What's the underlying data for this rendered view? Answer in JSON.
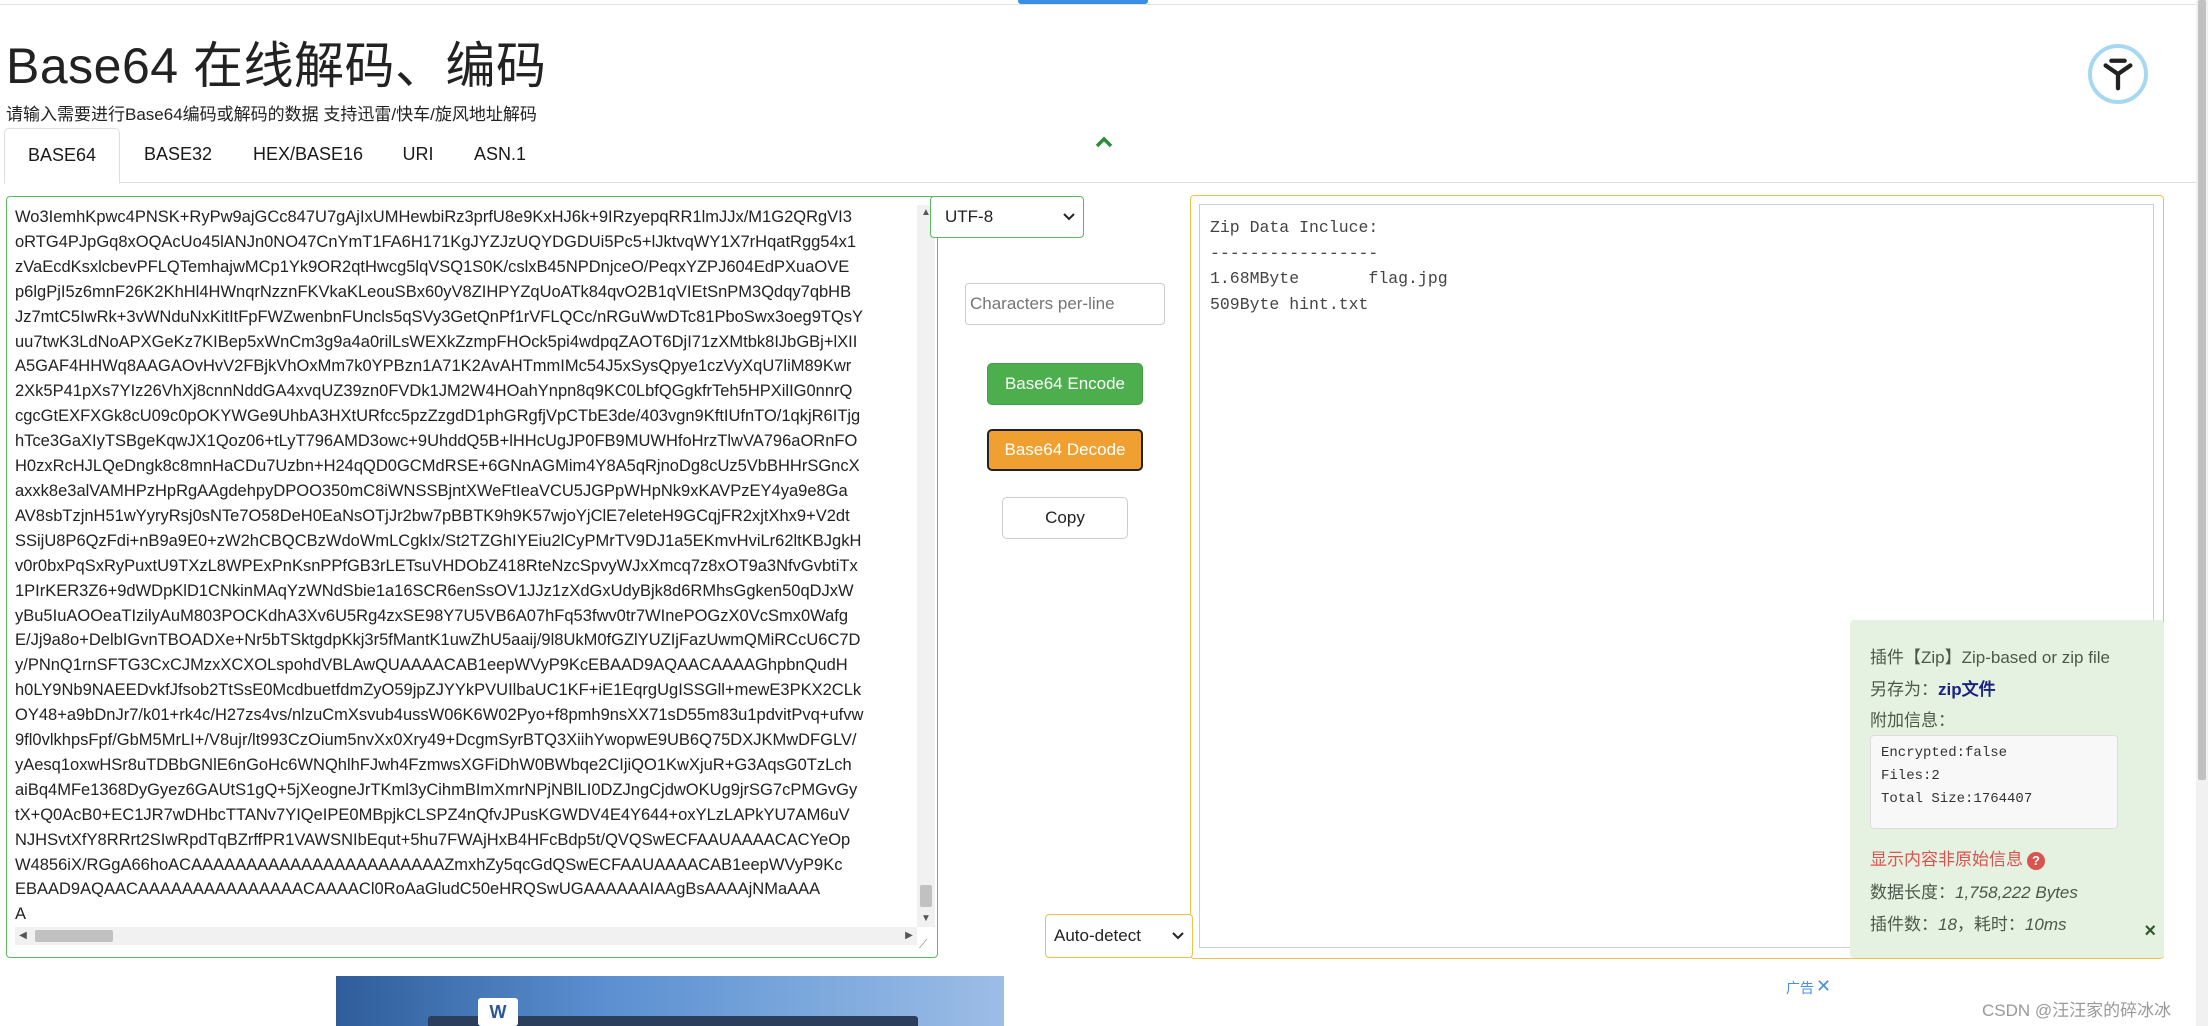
{
  "header": {
    "title": "Base64 在线解码、编码",
    "subtitle": "请输入需要进行Base64编码或解码的数据 支持迅雷/快车/旋风地址解码"
  },
  "tabs": [
    {
      "label": "BASE64",
      "active": true
    },
    {
      "label": "BASE32",
      "active": false
    },
    {
      "label": "HEX/BASE16",
      "active": false
    },
    {
      "label": "URI",
      "active": false
    },
    {
      "label": "ASN.1",
      "active": false
    }
  ],
  "input": {
    "lines": [
      "Wo3IemhKpwc4PNSK+RyPw9ajGCc847U7gAjIxUMHewbiRz3prfU8e9KxHJ6k+9IRzyepqRR1lmJJx/M1G2QRgVI3",
      "oRTG4PJpGq8xOQAcUo45lANJn0NO47CnYmT1FA6H171KgJYZJzUQYDGDUi5Pc5+lJktvqWY1X7rHqatRgg54x1",
      "zVaEcdKsxlcbevPFLQTemhajwMCp1Yk9OR2qtHwcg5lqVSQ1S0K/cslxB45NPDnjceO/PeqxYZPJ604EdPXuaOVE",
      "p6lgPjI5z6mnF26K2KhHl4HWnqrNzznFKVkaKLeouSBx60yV8ZIHPYZqUoATk84qvO2B1qVIEtSnPM3Qdqy7qbHB",
      "Jz7mtC5IwRk+3vWNduNxKitItFpFWZwenbnFUncls5qSVy3GetQnPf1rVFLQCc/nRGuWwDTc81PboSwx3oeg9TQsY",
      "uu7twK3LdNoAPXGeKz7KIBep5xWnCm3g9a4a0rilLsWEXkZzmpFHOck5pi4wdpqZAOT6DjI71zXMtbk8IJbGBj+lXII",
      "A5GAF4HHWq8AAGAOvHvV2FBjkVhOxMm7k0YPBzn1A71K2AvAHTmmIMc54J5xSysQpye1czVyXqU7liM89Kwr",
      "2Xk5P41pXs7YIz26VhXj8cnnNddGA4xvqUZ39zn0FVDk1JM2W4HOahYnpn8q9KC0LbfQGgkfrTeh5HPXilIG0nnrQ",
      "cgcGtEXFXGk8cU09c0pOKYWGe9UhbA3HXtURfcc5pzZzgdD1phGRgfjVpCTbE3de/403vgn9KftIUfnTO/1qkjR6ITjg",
      "hTce3GaXIyTSBgeKqwJX1Qoz06+tLyT796AMD3owc+9UhddQ5B+lHHcUgJP0FB9MUWHfoHrzTlwVA796aORnFO",
      "H0zxRcHJLQeDngk8c8mnHaCDu7Uzbn+H24qQD0GCMdRSE+6GNnAGMim4Y8A5qRjnoDg8cUz5VbBHHrSGncX",
      "axxk8e3alVAMHPzHpRgAAgdehpyDPOO350mC8iWNSSBjntXWeFtIeaVCU5JGPpWHpNk9xKAVPzEY4ya9e8Ga",
      "AV8sbTzjnH51wYyryRsj0sNTe7O58DeH0EaNsOTjJr2bw7pBBTK9h9K57wjoYjClE7eleteH9GCqjFR2xjtXhx9+V2dt",
      "SSijU8P6QzFdi+nB9a9E0+zW2hCBQCBzWdoWmLCgkIx/St2TZGhIYEiu2lCyPMrTV9DJ1a5EKmvHviLr62ltKBJgkH",
      "v0r0bxPqSxRyPuxtU9TXzL8WPExPnKsnPPfGB3rLETsuVHDObZ418RteNzcSpvyWJxXmcq7z8xOT9a3NfvGvbtiTx",
      "1PIrKER3Z6+9dWDpKlD1CNkinMAqYzWNdSbie1a16SCR6enSsOV1JJz1zXdGxUdyBjk8d6RMhsGgken50qDJxW",
      "yBu5IuAOOeaTIzilyAuM803POCKdhA3Xv6U5Rg4zxSE98Y7U5VB6A07hFq53fwv0tr7WInePOGzX0VcSmx0Wafg",
      "E/Jj9a8o+DelbIGvnTBOADXe+Nr5bTSktgdpKkj3r5fMantK1uwZhU5aaij/9l8UkM0fGZlYUZIjFazUwmQMiRCcU6C7D",
      "y/PNnQ1rnSFTG3CxCJMzxXCXOLspohdVBLAwQUAAAACAB1eepWVyP9KcEBAAD9AQAACAAAAGhpbnQudH",
      "h0LY9Nb9NAEEDvkfJfsob2TtSsE0McdbuetfdmZyO59jpZJYYkPVUIlbaUC1KF+iE1EqrgUgISSGll+mewE3PKX2CLk",
      "OY48+a9bDnJr7/k01+rk4c/H27zs4vs/nlzuCmXsvub4ussW06K6W02Pyo+f8pmh9nsXX71sD55m83u1pdvitPvq+ufvw",
      "9fl0vlkhpsFpf/GbM5MrLI+/V8ujr/lt993CzOium5nvXx0Xry49+DcgmSyrBTQ3XiihYwopwE9UB6Q75DXJKMwDFGLV/",
      "yAesq1oxwHSr8uTDBbGNlE6nGoHc6WNQhlhFJwh4FzmwsXGFiDhW0BWbqe2CIjiQO1KwXjuR+G3AqsG0TzLch",
      "aiBq4MFe1368DyGyez6GAUtS1gQ+5jXeogneJrTKml3yCihmBImXmrNPjNBlLI0DZJngCjdwOKUg9jrSG7cPMGvGy",
      "tX+Q0AcB0+EC1JR7wDHbcTTANv7YIQeIPE0MBpjkCLSPZ4nQfvJPusKGWDV4E4Y644+oxYLzLAPkYU7AM6uV",
      "NJHSvtXfY8RRrt2SIwRpdTqBZrffPR1VAWSNIbEqut+5hu7FWAjHxB4HFcBdp5t/QVQSwECFAAUAAAACACYeOp",
      "W4856iX/RGgA66hoACAAAAAAAAAAAAAAAAAAAAAAAZmxhZy5qcGdQSwECFAAUAAAACAB1eepWVyP9Kc",
      "EBAAD9AQAACAAAAAAAAAAAAAAACAAAACl0RoAaGludC50eHRQSwUGAAAAAAIAAgBsAAAAjNMaAAA",
      "A"
    ]
  },
  "charset": {
    "selected": "UTF-8"
  },
  "chars_per_line": {
    "placeholder": "Characters per-line"
  },
  "buttons": {
    "encode": "Base64 Encode",
    "decode": "Base64 Decode",
    "copy": "Copy"
  },
  "output": {
    "text": "Zip Data Incluce:\n-----------------\n1.68MByte       flag.jpg\n509Byte hint.txt"
  },
  "output_charset": {
    "selected": "Auto-detect"
  },
  "plugin": {
    "title": "插件【Zip】Zip-based or zip file",
    "save_as_label": "另存为：",
    "save_as_value": "zip文件",
    "extra_info_label": "附加信息：",
    "extra_info": "Encrypted:false\nFiles:2\nTotal Size:1764407",
    "warning": "显示内容非原始信息",
    "data_length_label": "数据长度：",
    "data_length_value": "1,758,222 Bytes",
    "plugin_count_label": "插件数：",
    "plugin_count_value": "18",
    "time_label": "，耗时：",
    "time_value": "10ms"
  },
  "ad": {
    "label": "广告"
  },
  "watermark": "CSDN @汪汪家的碎冰冰",
  "colors": {
    "encode_button": "#4cae4c",
    "decode_button": "#f0a030",
    "input_border": "#5cb85c",
    "output_border": "#f0c24a",
    "plugin_panel_bg": "#e6f2e1",
    "warning": "#d9534f"
  }
}
